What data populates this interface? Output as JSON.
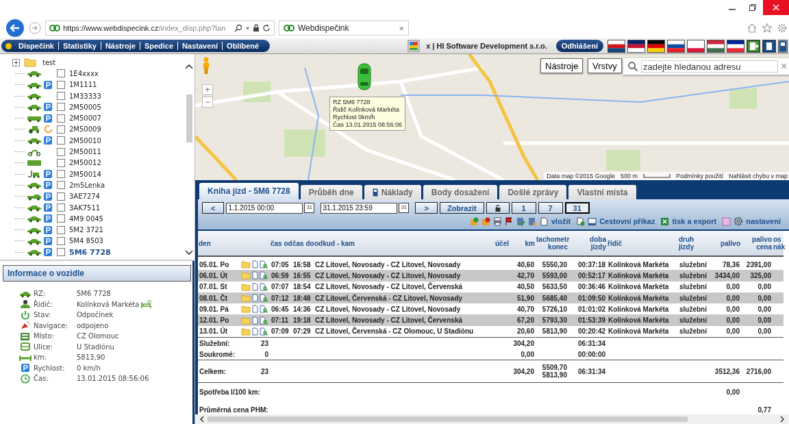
{
  "browser": {
    "url_host": "https://www.webdispecink.cz",
    "url_path": "/index_disp.php?lan",
    "tab_title": "Webdispečink",
    "tab_close": "×"
  },
  "app_bar": {
    "menu": [
      "Dispečink",
      "Statistiky",
      "Nástroje",
      "Spedice",
      "Nastavení",
      "Oblíbené"
    ],
    "company": "x | HI Software Development s.r.o.",
    "logout": "Odhlášení"
  },
  "tree": {
    "root": {
      "label": "test",
      "expand": "+"
    },
    "items": [
      {
        "label": "1E4xxxx",
        "kind": "car",
        "parked": false,
        "moving": false,
        "checked": false,
        "selected": false
      },
      {
        "label": "1M1111",
        "kind": "car",
        "parked": true,
        "moving": false,
        "checked": false,
        "selected": false
      },
      {
        "label": "1M33333",
        "kind": "car",
        "parked": false,
        "moving": false,
        "checked": false,
        "selected": false
      },
      {
        "label": "2M50005",
        "kind": "car",
        "parked": true,
        "moving": false,
        "checked": false,
        "selected": false
      },
      {
        "label": "2M50007",
        "kind": "bus",
        "parked": true,
        "moving": false,
        "checked": false,
        "selected": false
      },
      {
        "label": "2M50009",
        "kind": "tractor",
        "parked": false,
        "moving": true,
        "checked": false,
        "selected": false
      },
      {
        "label": "2M50010",
        "kind": "car",
        "parked": true,
        "moving": false,
        "checked": false,
        "selected": false
      },
      {
        "label": "2M50011",
        "kind": "moto",
        "parked": false,
        "moving": false,
        "checked": false,
        "selected": false
      },
      {
        "label": "2M50012",
        "kind": "truck",
        "parked": false,
        "moving": false,
        "checked": false,
        "selected": false
      },
      {
        "label": "2M50014",
        "kind": "forklift",
        "parked": true,
        "moving": false,
        "checked": false,
        "selected": false
      },
      {
        "label": "2m5Lenka",
        "kind": "car",
        "parked": true,
        "moving": false,
        "checked": false,
        "selected": false
      },
      {
        "label": "3AE7274",
        "kind": "pickup",
        "parked": true,
        "moving": false,
        "checked": false,
        "selected": false
      },
      {
        "label": "3AK7511",
        "kind": "car",
        "parked": true,
        "moving": false,
        "checked": false,
        "selected": false
      },
      {
        "label": "4M9 0045",
        "kind": "car",
        "parked": true,
        "moving": false,
        "checked": false,
        "selected": false
      },
      {
        "label": "5M2 3721",
        "kind": "car",
        "parked": true,
        "moving": false,
        "checked": false,
        "selected": false
      },
      {
        "label": "5M4 8503",
        "kind": "car",
        "parked": true,
        "moving": false,
        "checked": false,
        "selected": false
      },
      {
        "label": "5M6 7728",
        "kind": "car",
        "parked": true,
        "moving": false,
        "checked": false,
        "selected": true
      }
    ]
  },
  "vehicle_info": {
    "title": "Informace o vozidle",
    "rows": [
      {
        "kind": "car",
        "label": "RZ:",
        "value": "5M6 7728",
        "rest": false
      },
      {
        "kind": "driver",
        "label": "Řidič:",
        "value": "Kolínková Markéta",
        "rest": true
      },
      {
        "kind": "power",
        "label": "Stav:",
        "value": "Odpočinek",
        "rest": false
      },
      {
        "kind": "satellite",
        "label": "Navigace:",
        "value": "odpojeno",
        "rest": false
      },
      {
        "kind": "place",
        "label": "Místo:",
        "value": "CZ Olomouc",
        "rest": false
      },
      {
        "kind": "street",
        "label": "Ulice:",
        "value": "U Stadiónu",
        "rest": false
      },
      {
        "kind": "distance",
        "label": "km:",
        "value": "5813,90",
        "rest": false
      },
      {
        "kind": "parking",
        "label": "Rychlost:",
        "value": "0 km/h",
        "rest": false
      },
      {
        "kind": "clock",
        "label": "Čas:",
        "value": "13.01.2015 08:56:06",
        "rest": false
      }
    ]
  },
  "map": {
    "zoom_in": "+",
    "zoom_out": "−",
    "tools": "Nástroje",
    "layers": "Vrstvy",
    "search_placeholder": "zadejte hledanou adresu",
    "search_clear": "×",
    "popup": [
      "RZ 5M6 7728",
      "Řidič Kolínková Markéta",
      "Rychlost 0km/h",
      "Čas 13.01.2015 08:56:06"
    ],
    "attribution": "Data map ©2015 Google",
    "scale": "500 m",
    "terms": "Podmínky použití",
    "report": "Nahlásit chybu v map"
  },
  "tabs": [
    {
      "label": "Kniha jízd - 5M6 7728",
      "selected": true,
      "icon": false
    },
    {
      "label": "Průběh dne",
      "selected": false,
      "icon": false
    },
    {
      "label": "Náklady",
      "selected": false,
      "icon": true
    },
    {
      "label": "Body dosažení",
      "selected": false,
      "icon": false
    },
    {
      "label": "Došlé zprávy",
      "selected": false,
      "icon": false
    },
    {
      "label": "Vlastní místa",
      "selected": false,
      "icon": false
    }
  ],
  "filter": {
    "prev": "<",
    "date_from": "1.1.2015 00:00",
    "calendar_from": "31",
    "date_to": "31.1.2015 23:59",
    "calendar_to": "31",
    "next": ">",
    "show": "Zobrazit",
    "periods": [
      {
        "label": "1",
        "selected": false
      },
      {
        "label": "7",
        "selected": false
      },
      {
        "label": "31",
        "selected": true
      }
    ]
  },
  "actions": {
    "insert": "vložit",
    "travel_order": "Cestovní příkaz",
    "export": "tisk a export",
    "settings": "nastavení"
  },
  "table": {
    "columns": [
      [
        "den"
      ],
      [],
      [
        "čas od"
      ],
      [
        "čas do"
      ],
      [
        "odkud - kam"
      ],
      [
        "účel"
      ],
      [
        "km"
      ],
      [
        "tachometr",
        "konec"
      ],
      [
        "doba",
        "jízdy"
      ],
      [
        "řidič"
      ],
      [
        "druh",
        "jízdy"
      ],
      [
        "palivo"
      ],
      [
        "palivo",
        "cena"
      ],
      [
        "os",
        "nák"
      ]
    ],
    "rows": [
      {
        "den": "05.01. Po",
        "od": "07:05",
        "do": "16:58",
        "route": "CZ Litovel, Novosady - CZ Litovel, Novosady",
        "km": "40,60",
        "tacho": "5550,30",
        "doba": "00:37:18",
        "driver": "Kolínková Markéta",
        "type": "služební",
        "fuel": "78,36",
        "price": "2391,00"
      },
      {
        "den": "06.01. Út",
        "od": "06:59",
        "do": "16:55",
        "route": "CZ Litovel, Novosady - CZ Litovel, Novosady",
        "km": "42,70",
        "tacho": "5593,00",
        "doba": "00:52:17",
        "driver": "Kolínková Markéta",
        "type": "služební",
        "fuel": "3434,00",
        "price": "325,00"
      },
      {
        "den": "07.01. St",
        "od": "07:07",
        "do": "18:54",
        "route": "CZ Litovel, Novosady - CZ Litovel, Červenská",
        "km": "40,50",
        "tacho": "5633,50",
        "doba": "00:36:46",
        "driver": "Kolínková Markéta",
        "type": "služební",
        "fuel": "0,00",
        "price": "0,00"
      },
      {
        "den": "08.01. Čt",
        "od": "07:12",
        "do": "18:48",
        "route": "CZ Litovel, Červenská - CZ Litovel, Novosady",
        "km": "51,90",
        "tacho": "5685,40",
        "doba": "01:09:50",
        "driver": "Kolínková Markéta",
        "type": "služební",
        "fuel": "0,00",
        "price": "0,00"
      },
      {
        "den": "09.01. Pá",
        "od": "06:45",
        "do": "14:36",
        "route": "CZ Litovel, Novosady - CZ Litovel, Novosady",
        "km": "40,70",
        "tacho": "5726,10",
        "doba": "01:01:02",
        "driver": "Kolínková Markéta",
        "type": "služební",
        "fuel": "0,00",
        "price": "0,00"
      },
      {
        "den": "12.01. Po",
        "od": "07:11",
        "do": "19:18",
        "route": "CZ Litovel, Novosady - CZ Litovel, Červenská",
        "km": "67,20",
        "tacho": "5793,30",
        "doba": "01:53:39",
        "driver": "Kolínková Markéta",
        "type": "služební",
        "fuel": "0,00",
        "price": "0,00"
      },
      {
        "den": "13.01. Út",
        "od": "07:09",
        "do": "07:29",
        "route": "CZ Litovel, Červenská - CZ Olomouc, U Stadiónu",
        "km": "20,60",
        "tacho": "5813,90",
        "doba": "00:20:42",
        "driver": "Kolínková Markéta",
        "type": "služební",
        "fuel": "0,00",
        "price": "0,00"
      }
    ],
    "summary": [
      {
        "label": "Služební:",
        "count": "23",
        "km": "304,20",
        "doba": "06:31:34"
      },
      {
        "label": "Soukromé:",
        "count": "0",
        "km": "0,00",
        "doba": "00:00:00"
      },
      {
        "label": "Celkem:",
        "count": "23",
        "km": "304,20",
        "tacho": [
          "5509,70",
          "5813,90"
        ],
        "doba": "06:31:34",
        "fuel": "3512,36",
        "price": "2716,00"
      },
      {
        "label": "Spotřeba l/100 km:",
        "fuel": "0,00"
      },
      {
        "label": "Průměrná cena PHM:",
        "price": "0,77"
      }
    ]
  }
}
